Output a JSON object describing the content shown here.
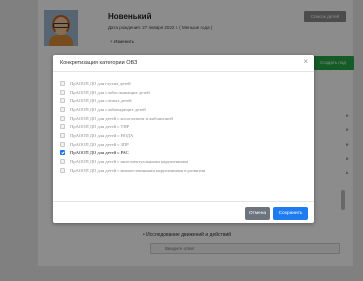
{
  "profile": {
    "name": "Новенький",
    "dob": "Дата рождения: 27 января 2022 г. ( Меньше года )",
    "sub_link": "+ Изменить",
    "top_button": "Список детей"
  },
  "page": {
    "green_button": "Создать под",
    "right_fragments": [
      "е",
      "е",
      "е",
      "е",
      "ь"
    ],
    "section_item": "• Исследование движений и действий",
    "answer_placeholder": "Введите ответ"
  },
  "modal": {
    "title": "Конкретизация категории ОВЗ",
    "close": "×",
    "options": [
      {
        "label": "ПрАООП ДО для глухих детей",
        "checked": false
      },
      {
        "label": "ПрАООП ДО для слабослышащих детей",
        "checked": false
      },
      {
        "label": "ПрАООП ДО для слепых детей",
        "checked": false
      },
      {
        "label": "ПрАООП ДО для слабовидящих детей",
        "checked": false
      },
      {
        "label": "ПрАООП ДО для детей с косоглазием и амблиопией",
        "checked": false
      },
      {
        "label": "ПрАООП ДО для детей с ТНР",
        "checked": false
      },
      {
        "label": "ПрАООП ДО для детей с НОДА",
        "checked": false
      },
      {
        "label": "ПрАООП ДО для детей с ЗПР",
        "checked": false
      },
      {
        "label": "ПрАООП ДО для детей с РАС",
        "checked": true
      },
      {
        "label": "ПрАООП ДО для детей с интеллектуальными нарушениями",
        "checked": false
      },
      {
        "label": "ПрАООП ДО для детей с множественными нарушениями в развитии",
        "checked": false
      }
    ],
    "cancel": "Отмена",
    "save": "Сохранить"
  }
}
